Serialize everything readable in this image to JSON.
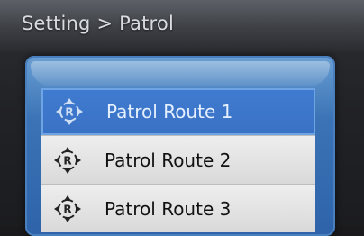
{
  "header": {
    "breadcrumb": "Setting > Patrol"
  },
  "routes": [
    {
      "label": "Patrol Route 1",
      "icon": "patrol-route-icon",
      "selected": true
    },
    {
      "label": "Patrol Route 2",
      "icon": "patrol-route-icon",
      "selected": false
    },
    {
      "label": "Patrol Route 3",
      "icon": "patrol-route-icon",
      "selected": false
    }
  ],
  "colors": {
    "panel_blue": "#3b73b6",
    "selected_row": "#3f7bd0",
    "row_light": "#e6e6e6"
  }
}
